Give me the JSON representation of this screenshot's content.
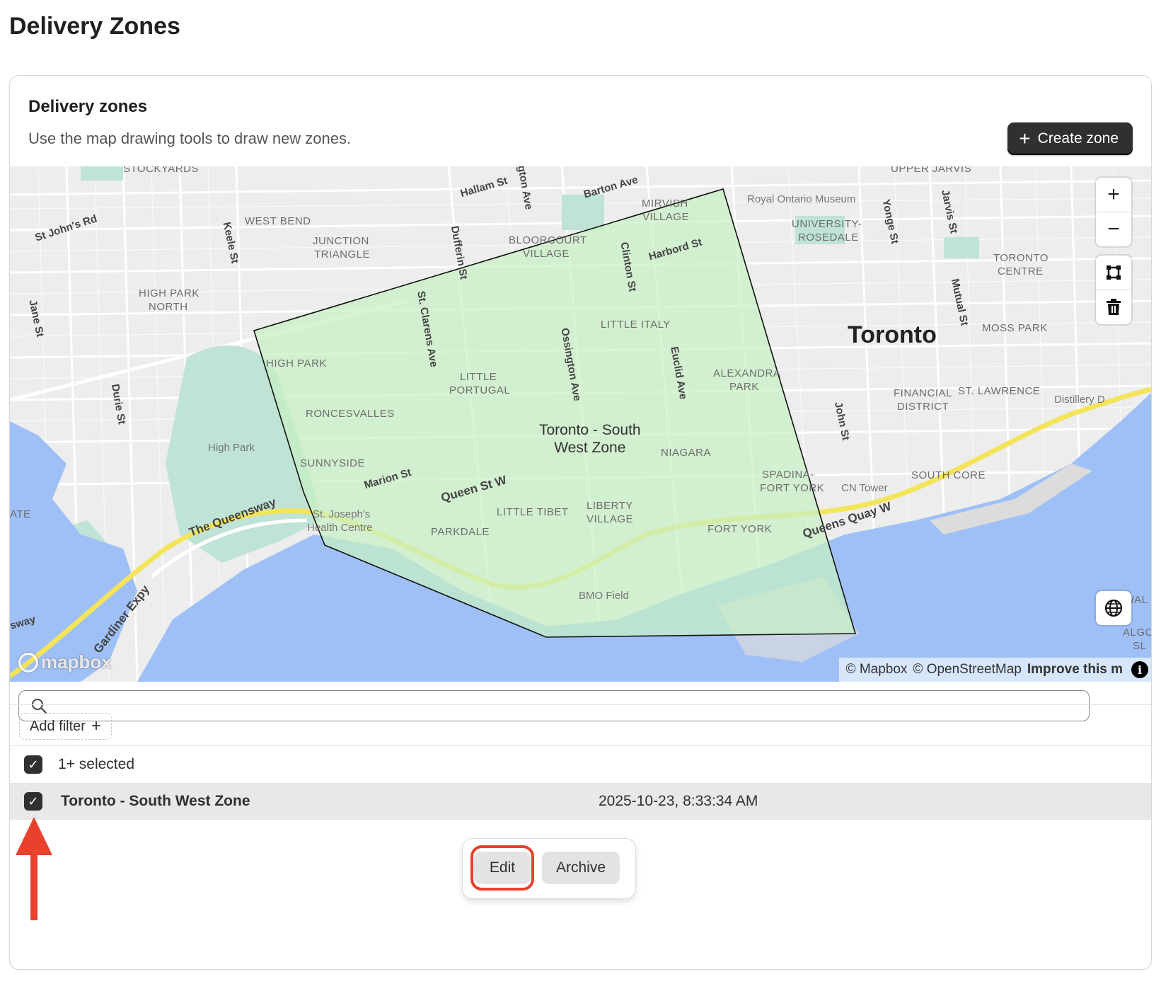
{
  "page": {
    "title": "Delivery Zones"
  },
  "card": {
    "title": "Delivery zones",
    "subtitle": "Use the map drawing tools to draw new zones.",
    "create_button": "Create zone"
  },
  "map": {
    "zone_name_line1": "Toronto - South",
    "zone_name_line2": "West Zone",
    "city": "Toronto",
    "neighbourhoods": [
      "STOCKYARDS",
      "WEST BEND",
      "JUNCTION",
      "TRIANGLE",
      "HIGH PARK",
      "NORTH",
      "BLOORCOURT",
      "VILLAGE",
      "MIRVISH",
      "VILLAGE",
      "UNIVERSITY-",
      "ROSEDALE",
      "TORONTO",
      "CENTRE",
      "MOSS PARK",
      "LITTLE ITALY",
      "HIGH PARK",
      "LITTLE",
      "PORTUGAL",
      "ALEXANDRA",
      "PARK",
      "RONCESVALLES",
      "FINANCIAL",
      "DISTRICT",
      "ST. LAWRENCE",
      "SUNNYSIDE",
      "NIAGARA",
      "SPADINA-",
      "FORT YORK",
      "SOUTH CORE",
      "LITTLE TIBET",
      "LIBERTY",
      "VILLAGE",
      "PARKDALE",
      "FORT YORK",
      "ATE",
      "UPPER JARVIS",
      "WAL",
      "ALGO",
      "SL"
    ],
    "streets": [
      "St John's Rd",
      "Keele St",
      "Jane St",
      "Durie St",
      "Hallam St",
      "gton Ave",
      "Barton Ave",
      "Dufferin St",
      "St. Clarens Ave",
      "Clinton St",
      "Harbord St",
      "Ossington Ave",
      "Euclid Ave",
      "Marion St",
      "Queen St W",
      "The Queensway",
      "Yonge St",
      "Jarvis St",
      "Mutual St",
      "John St",
      "Queens Quay W",
      "Gardiner Expy",
      "sway"
    ],
    "pois": [
      "Royal Ontario Museum",
      "High Park",
      "St. Joseph's",
      "Health Centre",
      "CN Tower",
      "BMO Field",
      "Distillery D"
    ],
    "zoom_in_icon": "plus-icon",
    "zoom_out_icon": "minus-icon",
    "draw_icon": "polygon-draw-icon",
    "trash_icon": "trash-icon",
    "globe_icon": "globe-icon",
    "logo": "mapbox",
    "attribution": {
      "mapbox": "© Mapbox",
      "osm": "© OpenStreetMap",
      "improve": "Improve this m"
    },
    "colors": {
      "zone_fill": "#c8f0c4",
      "water": "#9ec0f7",
      "park": "#bfe3d4",
      "highway": "#f3e45a"
    }
  },
  "search": {
    "placeholder": "",
    "value": ""
  },
  "filters": {
    "add_filter_label": "Add filter"
  },
  "list": {
    "selected_label": "1+ selected",
    "rows": [
      {
        "name": "Toronto - South West Zone",
        "date": "2025-10-23, 8:33:34 AM"
      }
    ]
  },
  "actions": {
    "edit_label": "Edit",
    "archive_label": "Archive"
  },
  "annotation_color": "#e8412c"
}
